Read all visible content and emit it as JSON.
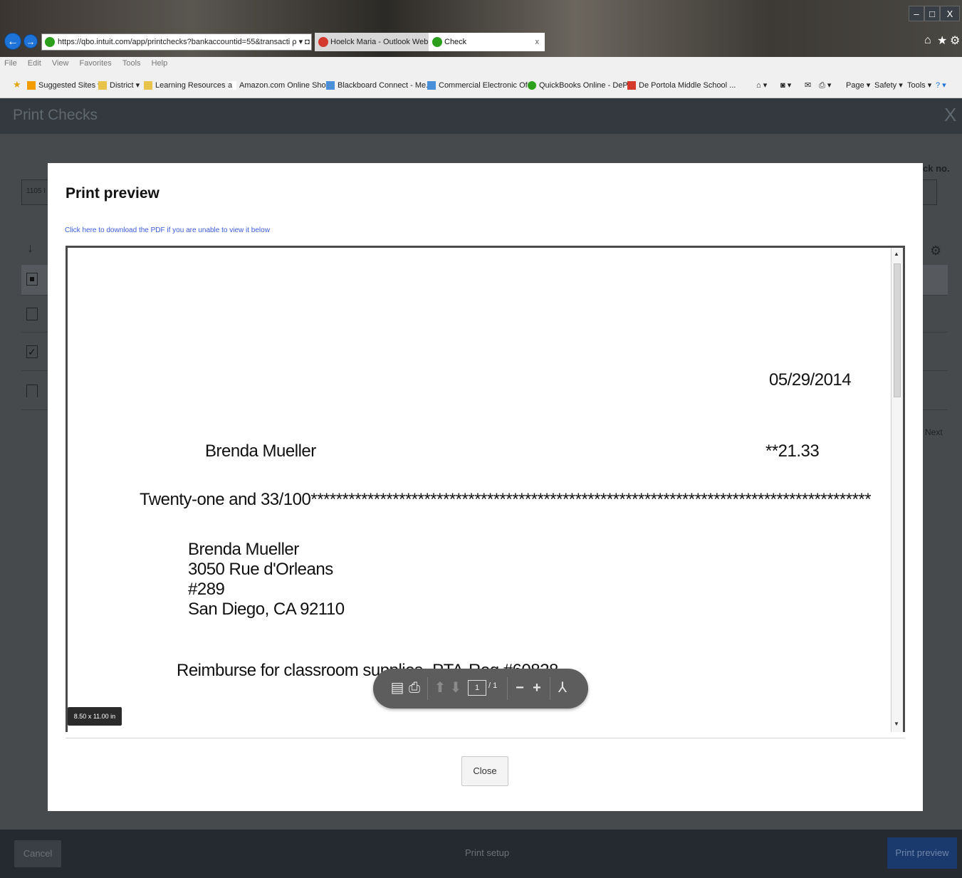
{
  "browser": {
    "window_buttons": [
      "–",
      "□",
      "X"
    ],
    "address": "https://qbo.intuit.com/app/printchecks?bankaccountid=55&transacti ρ ▾ ◘ C",
    "tabs": [
      {
        "label": "Hoelck Maria - Outlook Web A...",
        "close": ""
      },
      {
        "label": "Check",
        "close": "x"
      }
    ],
    "menu": [
      "File",
      "Edit",
      "View",
      "Favorites",
      "Tools",
      "Help"
    ],
    "favorites": [
      "Suggested Sites ▾",
      "District ▾",
      "Learning Resources ▾",
      "Amazon.com Online Sho...",
      "Blackboard Connect - Me...",
      "Commercial Electronic Of...",
      "QuickBooks Online - DeP...",
      "De Portola Middle School ..."
    ],
    "commands": [
      "Page ▾",
      "Safety ▾",
      "Tools ▾"
    ]
  },
  "app": {
    "title": "Print Checks",
    "close_glyph": "X",
    "bg_check_no_label": "ck no.",
    "bg_account_value": "1105 I",
    "bg_next": "Next",
    "footer": {
      "cancel": "Cancel",
      "print_setup": "Print setup",
      "print_preview": "Print preview"
    }
  },
  "modal": {
    "title": "Print preview",
    "pdf_link": "Click here to download the PDF if you are unable to view it below",
    "check": {
      "date": "05/29/2014",
      "payee": "Brenda Mueller",
      "amount": "**21.33",
      "amount_words": "Twenty-one and 33/100*****************************************************************************************",
      "address": [
        "Brenda Mueller",
        "3050 Rue d'Orleans",
        "#289",
        "San Diego, CA  92110"
      ],
      "memo": "Reimburse for classroom supplies- PTA-Req.#60828"
    },
    "pdf_toolbar": {
      "page_current": "1",
      "page_total": "/ 1"
    },
    "page_size": "8.50 x 11.00 in",
    "close_label": "Close"
  }
}
